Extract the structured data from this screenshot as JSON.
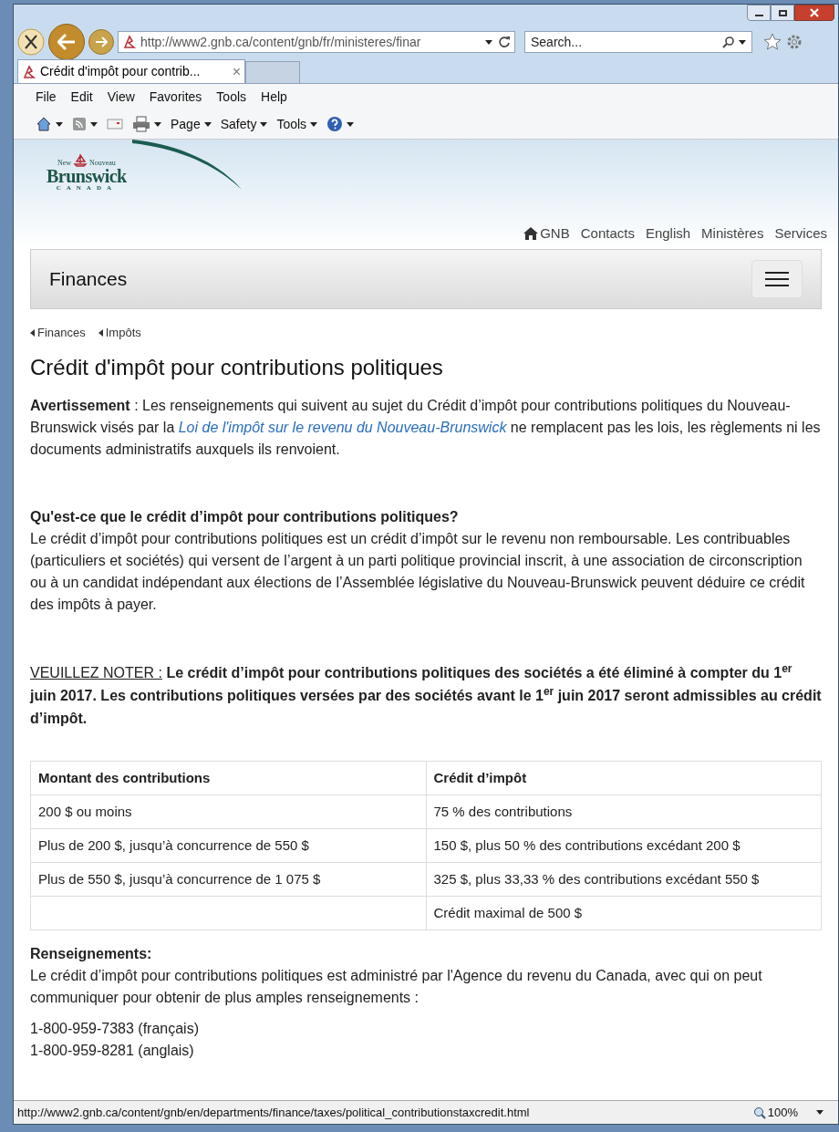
{
  "browser": {
    "address": "http://www2.gnb.ca/content/gnb/fr/ministeres/finar",
    "search_placeholder": "Search...",
    "tab": {
      "label": "Crédit d'impôt pour contrib...",
      "close": "×",
      "selected": true
    },
    "menu": [
      "File",
      "Edit",
      "View",
      "Favorites",
      "Tools",
      "Help"
    ],
    "commands": [
      "Page",
      "Safety",
      "Tools"
    ]
  },
  "logo": {
    "top_left": "New",
    "top_right": "Nouveau",
    "main": "Brunswick",
    "sub": "CANADA"
  },
  "top_links": [
    "GNB",
    "Contacts",
    "English",
    "Ministères",
    "Services"
  ],
  "section_bar": {
    "title": "Finances"
  },
  "breadcrumbs": [
    "Finances",
    "Impôts"
  ],
  "title": "Crédit d'impôt pour contributions politiques",
  "warning": {
    "label": "Avertissement",
    "before": " : Les renseignements qui suivent au sujet du Crédit d’impôt pour contributions politiques du Nouveau-Brunswick visés par la ",
    "link": "Loi de l'impôt sur le revenu du Nouveau-Brunswick",
    "after": " ne remplacent pas les lois, les règlements ni les documents administratifs auxquels ils renvoient."
  },
  "question": {
    "heading": "Qu'est-ce que le crédit d’impôt pour contributions politiques?",
    "text": "Le crédit d’impôt pour contributions politiques est un crédit d’impôt sur le revenu non remboursable. Les contribuables (particuliers et sociétés) qui versent de l’argent à un parti politique provincial inscrit, à une association de circonscription ou à un candidat indépendant aux élections de l’Assemblée législative du Nouveau-Brunswick peuvent déduire ce crédit des impôts à payer."
  },
  "notice": {
    "label": "VEUILLEZ NOTER :",
    "text": "Le crédit d’impôt pour contributions politiques des sociétés a été éliminé à compter du 1$^{er}$ juin 2017. Les contributions politiques versées par des sociétés avant le 1$^{er}$ juin 2017 seront admissibles au crédit d’impôt."
  },
  "table": {
    "columns": [
      "Montant des contributions",
      "Crédit d’impôt"
    ],
    "rows": [
      [
        "200 $ ou moins",
        "75 % des contributions"
      ],
      [
        "Plus de 200 $, jusqu’à concurrence de 550 $",
        "150 $, plus 50 % des contributions excédant 200 $"
      ],
      [
        "Plus de 550 $, jusqu’à concurrence de 1 075 $",
        "325 $, plus 33,33 % des contributions excédant 550 $"
      ],
      [
        "",
        "Crédit maximal de 500 $"
      ]
    ]
  },
  "info": {
    "heading": "Renseignements:",
    "text": "Le crédit d’impôt pour contributions politiques est administré par l'Agence du revenu du Canada, avec qui on peut communiquer pour obtenir de plus amples renseignements :",
    "phones": [
      "1-800-959-7383 (français)",
      "1-800-959-8281 (anglais)"
    ]
  },
  "status_bar": {
    "url": "http://www2.gnb.ca/content/gnb/en/departments/finance/taxes/political_contributionstaxcredit.html",
    "zoom": "100%"
  }
}
